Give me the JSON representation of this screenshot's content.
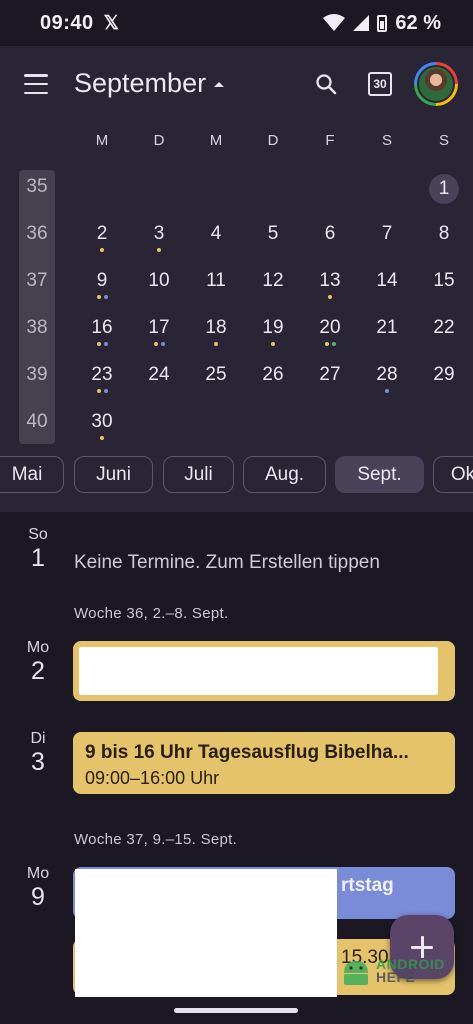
{
  "status": {
    "time": "09:40",
    "x_logo": "𝕏",
    "battery": "62 %"
  },
  "header": {
    "month": "September",
    "today_icon_text": "30"
  },
  "weekdays": [
    "M",
    "D",
    "M",
    "D",
    "F",
    "S",
    "S"
  ],
  "weeks": [
    {
      "week": "35",
      "days": [
        "",
        "",
        "",
        "",
        "",
        "",
        "1"
      ]
    },
    {
      "week": "36",
      "days": [
        "2",
        "3",
        "4",
        "5",
        "6",
        "7",
        "8"
      ]
    },
    {
      "week": "37",
      "days": [
        "9",
        "10",
        "11",
        "12",
        "13",
        "14",
        "15"
      ]
    },
    {
      "week": "38",
      "days": [
        "16",
        "17",
        "18",
        "19",
        "20",
        "21",
        "22"
      ]
    },
    {
      "week": "39",
      "days": [
        "23",
        "24",
        "25",
        "26",
        "27",
        "28",
        "29"
      ]
    },
    {
      "week": "40",
      "days": [
        "30",
        "",
        "",
        "",
        "",
        "",
        ""
      ]
    }
  ],
  "event_dots": {
    "2": [
      "#e5c36a"
    ],
    "3": [
      "#e5c36a"
    ],
    "9": [
      "#e5c36a",
      "#7a8bd8"
    ],
    "13": [
      "#e5c36a"
    ],
    "16": [
      "#e5c36a",
      "#7a8bd8"
    ],
    "17": [
      "#e5c36a",
      "#7a8bd8"
    ],
    "18": [
      "#e5c36a"
    ],
    "19": [
      "#e5c36a"
    ],
    "20": [
      "#e5c36a",
      "#5fb36a"
    ],
    "23": [
      "#e5c36a",
      "#7a8bd8"
    ],
    "28": [
      "#7a8bd8"
    ],
    "30": [
      "#e5c36a"
    ]
  },
  "months": [
    "Mai",
    "Juni",
    "Juli",
    "Aug.",
    "Sept.",
    "Ok"
  ],
  "agenda": {
    "day1": {
      "dow": "So",
      "num": "1",
      "empty": "Keine Termine. Zum Erstellen tippen"
    },
    "week36": "Woche 36, 2.–8. Sept.",
    "day2": {
      "dow": "Mo",
      "num": "2"
    },
    "day3": {
      "dow": "Di",
      "num": "3",
      "event_title": "9 bis 16 Uhr Tagesausflug Bibelha...",
      "event_time": "09:00–16:00 Uhr"
    },
    "week37": "Woche 37, 9.–15. Sept.",
    "day9": {
      "dow": "Mo",
      "num": "9",
      "event_partial": "rtstag",
      "event2_partial": "15.30"
    }
  },
  "watermark": {
    "line1": "ANDROID",
    "line2": "HEFE"
  },
  "colors": {
    "background": "#1b1824",
    "panel": "#2a2535",
    "event_yellow": "#e5c36a",
    "event_blue": "#7a8bd8"
  }
}
